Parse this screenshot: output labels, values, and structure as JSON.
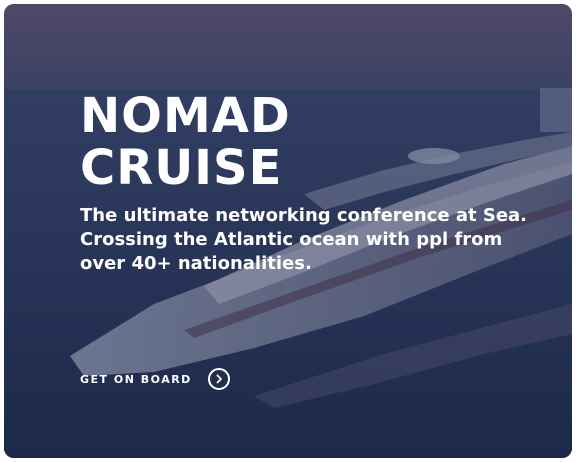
{
  "hero": {
    "title_line1": "NOMAD",
    "title_line2": "CRUISE",
    "description": "The ultimate networking conference at Sea. Crossing the Atlantic ocean with ppl from over 40+ nationalities.",
    "cta_label": "GET ON BOARD",
    "cta_icon": "chevron-right-icon"
  },
  "colors": {
    "text": "#ffffff",
    "overlay_top": "#5a5070",
    "overlay_bottom": "#1c2748"
  }
}
